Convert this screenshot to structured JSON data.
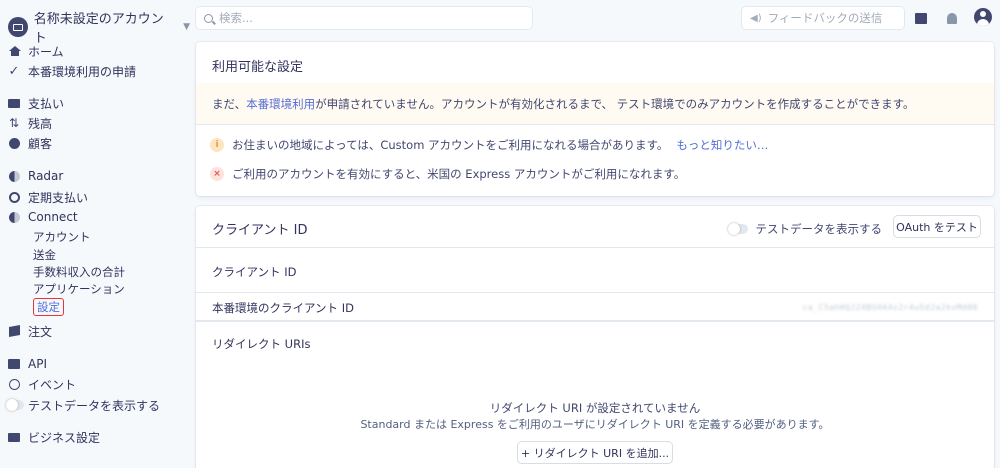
{
  "account": {
    "name": "名称未設定のアカウント"
  },
  "sidebar": {
    "items": [
      {
        "label": "ホーム",
        "icon": "home-icon"
      },
      {
        "label": "本番環境利用の申請",
        "icon": "check-icon"
      },
      {
        "label": "支払い",
        "icon": "card-icon"
      },
      {
        "label": "残高",
        "icon": "arrows-icon"
      },
      {
        "label": "顧客",
        "icon": "user-circle-icon"
      },
      {
        "label": "Radar",
        "icon": "radar-icon"
      },
      {
        "label": "定期支払い",
        "icon": "subscription-icon"
      },
      {
        "label": "Connect",
        "icon": "connect-icon"
      }
    ],
    "connect_sub": [
      "アカウント",
      "送金",
      "手数料収入の合計",
      "アプリケーション",
      "設定"
    ],
    "orders": "注文",
    "api": "API",
    "events": "イベント",
    "test_data": "テストデータを表示する",
    "business": "ビジネス設定"
  },
  "header": {
    "search_placeholder": "検索...",
    "feedback_placeholder": "フィードバックの送信"
  },
  "settings_card": {
    "title": "利用可能な設定",
    "banner_prefix": "まだ、",
    "banner_link": "本番環境利用",
    "banner_suffix": "が申請されていません。アカウントが有効化されるまで、 テスト環境でのみアカウントを作成することができます。",
    "notice1_text": "お住まいの地域によっては、Custom アカウントをご利用になれる場合があります。",
    "notice1_link": "もっと知りたい…",
    "notice2_text": "ご利用のアカウントを有効にすると、米国の Express アカウントがご利用になれます。"
  },
  "client_card": {
    "title": "クライアント ID",
    "toggle_label": "テストデータを表示する",
    "oauth_button": "OAuth をテスト",
    "client_id_header": "クライアント ID",
    "live_client_label": "本番環境のクライアント ID",
    "live_client_value": "ca_C5ahHQJ24BSH44s2r4u5d2a2kvMd08",
    "redirect_title": "リダイレクト URIs",
    "empty_title": "リダイレクト URI が設定されていません",
    "empty_desc": "Standard または Express をご利用のユーザにリダイレクト URI を定義する必要があります。",
    "add_button": "+ リダイレクト URI を追加..."
  },
  "colors": {
    "accent": "#556cd6",
    "text": "#32325d",
    "highlight_border": "#e8333a",
    "banner_bg": "#fffbf2"
  }
}
